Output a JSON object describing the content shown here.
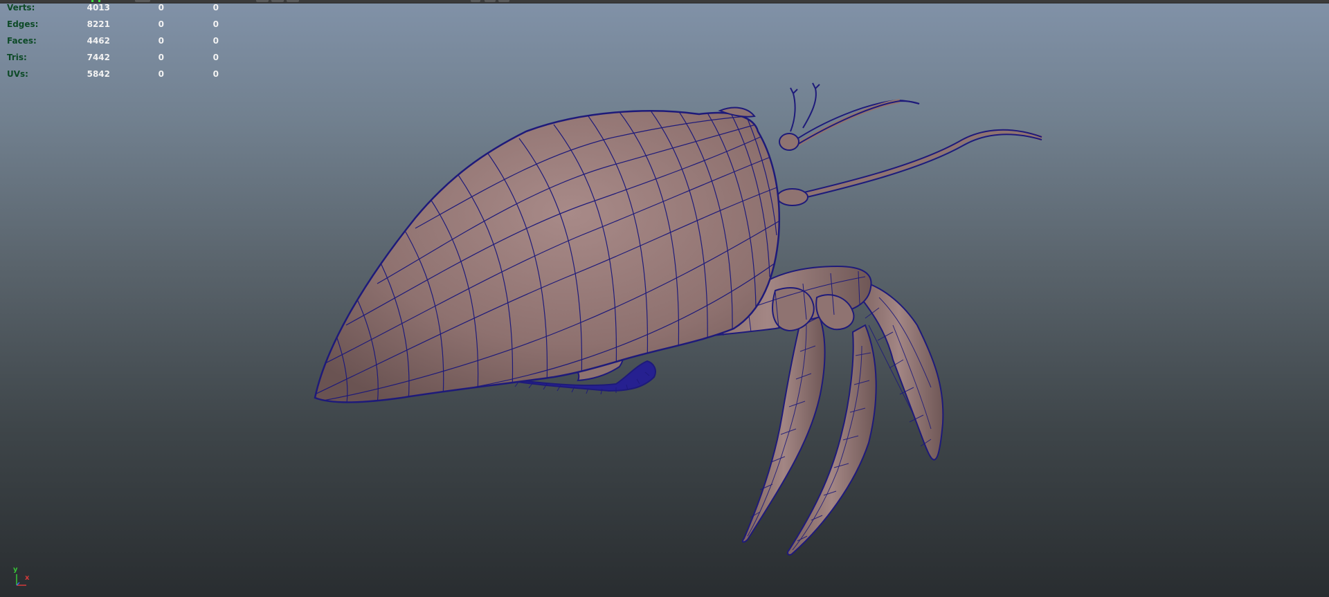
{
  "hud": {
    "rows": [
      {
        "label": "Verts:",
        "values": [
          "4013",
          "0",
          "0"
        ]
      },
      {
        "label": "Edges:",
        "values": [
          "8221",
          "0",
          "0"
        ]
      },
      {
        "label": "Faces:",
        "values": [
          "4462",
          "0",
          "0"
        ]
      },
      {
        "label": "Tris:",
        "values": [
          "7442",
          "0",
          "0"
        ]
      },
      {
        "label": "UVs:",
        "values": [
          "5842",
          "0",
          "0"
        ]
      }
    ]
  },
  "axis": {
    "y": "y",
    "x": "x"
  },
  "colors": {
    "hud_label": "#0d4a27",
    "hud_value": "#f2f2f2",
    "wireframe": "#1e1a7a",
    "model_shade": "#8f7371",
    "axis_x": "#d63a3a",
    "axis_y": "#37c437",
    "axis_z": "#3b6fe0"
  },
  "icons": {
    "axis": "view-axis-icon"
  }
}
